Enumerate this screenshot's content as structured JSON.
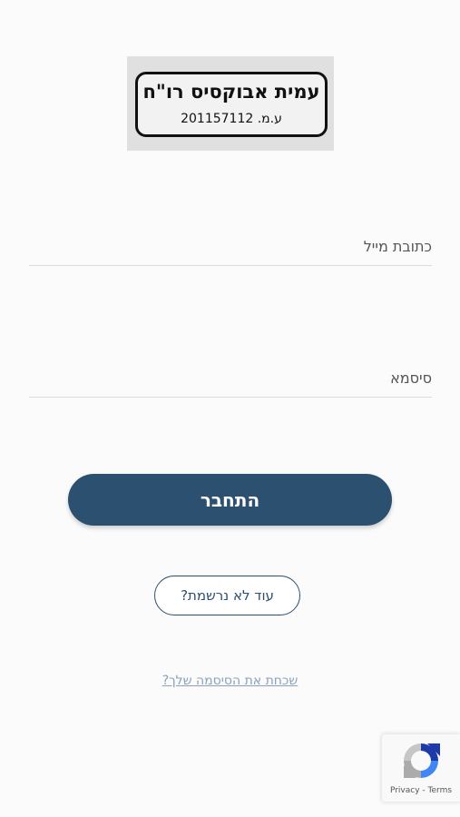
{
  "logo": {
    "name": "עמית אבוקסיס רו\"ח",
    "registration": "ע.מ. 201157112"
  },
  "form": {
    "email_placeholder": "כתובת מייל",
    "password_placeholder": "סיסמא",
    "login_label": "התחבר",
    "register_label": "עוד לא נרשמת?",
    "forgot_label": "שכחת את הסיסמה שלך?"
  },
  "recaptcha": {
    "privacy": "Privacy",
    "separator": "-",
    "terms": "Terms",
    "icon": "recaptcha-logo"
  },
  "colors": {
    "primary": "#2b5070",
    "link": "#8aa2b8",
    "background": "#fbfbfb"
  }
}
